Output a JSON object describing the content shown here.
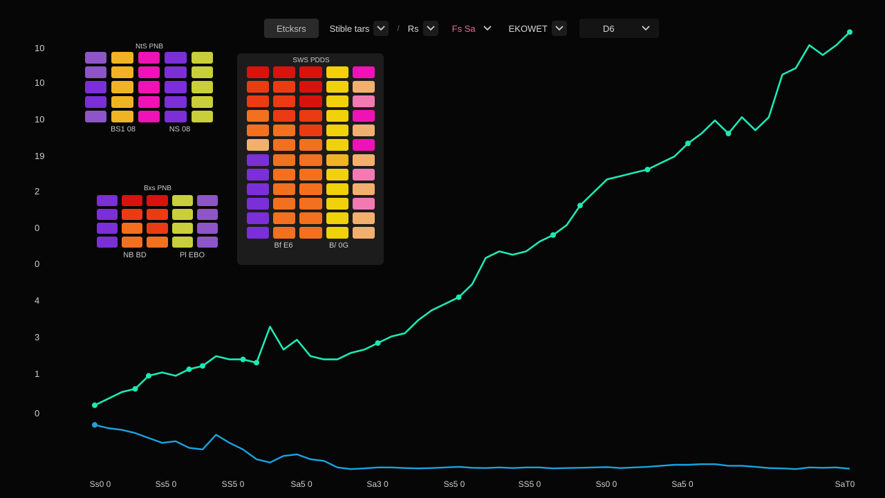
{
  "toolbar": {
    "tab_active": "Etcksrs",
    "drop1": "Stible tars",
    "drop2": "Rs",
    "drop3": "Fs Sa",
    "drop4": "EKOWET",
    "drop5": "D6"
  },
  "colors": {
    "line_main": "#1de9b6",
    "line_lower": "#1aa3e0",
    "purple": "#7b2fd6",
    "lilac": "#8e55c9",
    "yellow": "#f0b323",
    "lime": "#c8cf3a",
    "magenta": "#f012b5",
    "red": "#d8120e",
    "redorange": "#ea3b13",
    "orange": "#f3701f",
    "gold": "#f1d10a",
    "peach": "#f2b06e",
    "pink": "#f27ab3"
  },
  "chart_data": {
    "type": "line",
    "y_tick_labels": [
      "10",
      "10",
      "10",
      "19",
      "2",
      "0",
      "0",
      "4",
      "3",
      "1",
      "0"
    ],
    "x_tick_labels": [
      "Ss0 0",
      "Ss5 0",
      "SS5 0",
      "Sa5 0",
      "Sa3 0",
      "Ss5 0",
      "SS5 0",
      "Ss0 0",
      "Sa5 0",
      "SaT0"
    ],
    "series": [
      {
        "x": [
          0,
          1,
          2,
          3,
          4,
          5,
          6,
          7,
          8,
          9,
          10,
          11,
          12,
          13,
          14,
          15,
          16,
          17,
          18,
          19,
          20,
          21,
          22,
          23,
          24,
          25,
          26,
          27,
          28,
          29,
          30,
          31,
          32,
          33,
          34,
          35,
          36,
          37,
          38,
          39,
          40,
          41,
          42,
          43,
          44,
          45,
          46,
          47,
          48,
          49,
          50,
          51,
          52,
          53,
          54,
          55,
          56
        ],
        "y": [
          0.6,
          0.8,
          1.0,
          1.1,
          1.5,
          1.6,
          1.5,
          1.7,
          1.8,
          2.1,
          2.0,
          2.0,
          1.9,
          3.0,
          2.3,
          2.6,
          2.1,
          2.0,
          2.0,
          2.2,
          2.3,
          2.5,
          2.7,
          2.8,
          3.2,
          3.5,
          3.7,
          3.9,
          4.3,
          5.1,
          5.3,
          5.2,
          5.3,
          5.6,
          5.8,
          6.1,
          6.7,
          7.1,
          7.5,
          7.6,
          7.7,
          7.8,
          8.0,
          8.2,
          8.6,
          8.9,
          9.3,
          8.9,
          9.4,
          9.0,
          9.4,
          10.7,
          10.9,
          11.6,
          11.3,
          11.6,
          12.0
        ],
        "markers": [
          0,
          3,
          4,
          7,
          8,
          11,
          12,
          21,
          27,
          34,
          36,
          41,
          44,
          47,
          56
        ]
      },
      {
        "x": [
          0,
          1,
          2,
          3,
          4,
          5,
          6,
          7,
          8,
          9,
          10,
          11,
          12,
          13,
          14,
          15,
          16,
          17,
          18,
          19,
          20,
          21,
          22,
          23,
          24,
          25,
          26,
          27,
          28,
          29,
          30,
          31,
          32,
          33,
          34,
          35,
          36,
          37,
          38,
          39,
          40,
          41,
          42,
          43,
          44,
          45,
          46,
          47,
          48,
          49,
          50,
          51,
          52,
          53,
          54,
          55,
          56
        ],
        "y": [
          0.0,
          -0.1,
          -0.15,
          -0.25,
          -0.4,
          -0.55,
          -0.5,
          -0.7,
          -0.75,
          -0.3,
          -0.55,
          -0.75,
          -1.05,
          -1.15,
          -0.95,
          -0.9,
          -1.05,
          -1.1,
          -1.3,
          -1.35,
          -1.33,
          -1.3,
          -1.3,
          -1.32,
          -1.33,
          -1.32,
          -1.3,
          -1.28,
          -1.31,
          -1.32,
          -1.3,
          -1.32,
          -1.3,
          -1.3,
          -1.33,
          -1.32,
          -1.31,
          -1.3,
          -1.29,
          -1.32,
          -1.3,
          -1.28,
          -1.25,
          -1.22,
          -1.22,
          -1.2,
          -1.2,
          -1.25,
          -1.25,
          -1.28,
          -1.32,
          -1.33,
          -1.35,
          -1.3,
          -1.31,
          -1.3,
          -1.34
        ],
        "markers": [
          0
        ]
      }
    ],
    "ylim": [
      -1.6,
      11.5
    ]
  },
  "heatmaps": [
    {
      "title": "NtS PNB",
      "foot_left": "BS1 08",
      "foot_right": "NS 08",
      "rows": [
        [
          "lilac",
          "yellow",
          "magenta",
          "purple",
          "lime"
        ],
        [
          "lilac",
          "yellow",
          "magenta",
          "purple",
          "lime"
        ],
        [
          "purple",
          "yellow",
          "magenta",
          "purple",
          "lime"
        ],
        [
          "purple",
          "yellow",
          "magenta",
          "purple",
          "lime"
        ],
        [
          "lilac",
          "yellow",
          "magenta",
          "purple",
          "lime"
        ]
      ]
    },
    {
      "title": "SWS PDDS",
      "foot_left": "Bf E6",
      "foot_right": "B/ 0G",
      "rows": [
        [
          "red",
          "red",
          "red",
          "gold",
          "magenta"
        ],
        [
          "redorange",
          "redorange",
          "red",
          "gold",
          "peach"
        ],
        [
          "redorange",
          "redorange",
          "red",
          "gold",
          "pink"
        ],
        [
          "orange",
          "redorange",
          "redorange",
          "gold",
          "magenta"
        ],
        [
          "orange",
          "orange",
          "redorange",
          "gold",
          "peach"
        ],
        [
          "peach",
          "orange",
          "orange",
          "gold",
          "magenta"
        ],
        [
          "purple",
          "orange",
          "orange",
          "yellow",
          "peach"
        ],
        [
          "purple",
          "orange",
          "orange",
          "gold",
          "pink"
        ],
        [
          "purple",
          "orange",
          "orange",
          "gold",
          "peach"
        ],
        [
          "purple",
          "orange",
          "orange",
          "gold",
          "pink"
        ],
        [
          "purple",
          "orange",
          "orange",
          "gold",
          "peach"
        ],
        [
          "purple",
          "orange",
          "orange",
          "gold",
          "peach"
        ]
      ]
    },
    {
      "title": "Bxs PNB",
      "foot_left": "NB BD",
      "foot_right": "Pl EBO",
      "rows": [
        [
          "purple",
          "red",
          "red",
          "lime",
          "lilac"
        ],
        [
          "purple",
          "redorange",
          "redorange",
          "lime",
          "lilac"
        ],
        [
          "purple",
          "orange",
          "redorange",
          "lime",
          "lilac"
        ],
        [
          "purple",
          "orange",
          "orange",
          "lime",
          "lilac"
        ]
      ]
    }
  ]
}
